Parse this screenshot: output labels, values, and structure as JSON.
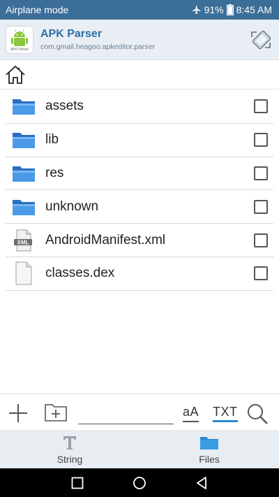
{
  "status_bar": {
    "left_text": "Airplane mode",
    "battery": "91%",
    "time": "8:45 AM"
  },
  "app_bar": {
    "title": "APK Parser",
    "subtitle": "com.gmail.heagoo.apkeditor.parser",
    "logo_caption": "APK Parser"
  },
  "files": [
    {
      "name": "assets",
      "icon": "folder-icon",
      "checked": false
    },
    {
      "name": "lib",
      "icon": "folder-icon",
      "checked": false
    },
    {
      "name": "res",
      "icon": "folder-icon",
      "checked": false
    },
    {
      "name": "unknown",
      "icon": "folder-icon",
      "checked": false
    },
    {
      "name": "AndroidManifest.xml",
      "icon": "xml-file-icon",
      "checked": false
    },
    {
      "name": "classes.dex",
      "icon": "file-icon",
      "checked": false
    }
  ],
  "xml_badge": "XML",
  "toolbar": {
    "search_value": "",
    "case_label": "aA",
    "txt_label": "TXT"
  },
  "tabs": [
    {
      "label": "String",
      "icon": "text-t-icon",
      "active": false
    },
    {
      "label": "Files",
      "icon": "folder-tab-icon",
      "active": true
    }
  ],
  "colors": {
    "status_bar": "#3b6e98",
    "app_title": "#2e6fa8",
    "folder": "#3d8fe0",
    "tab_active": "#2a8ad4"
  }
}
